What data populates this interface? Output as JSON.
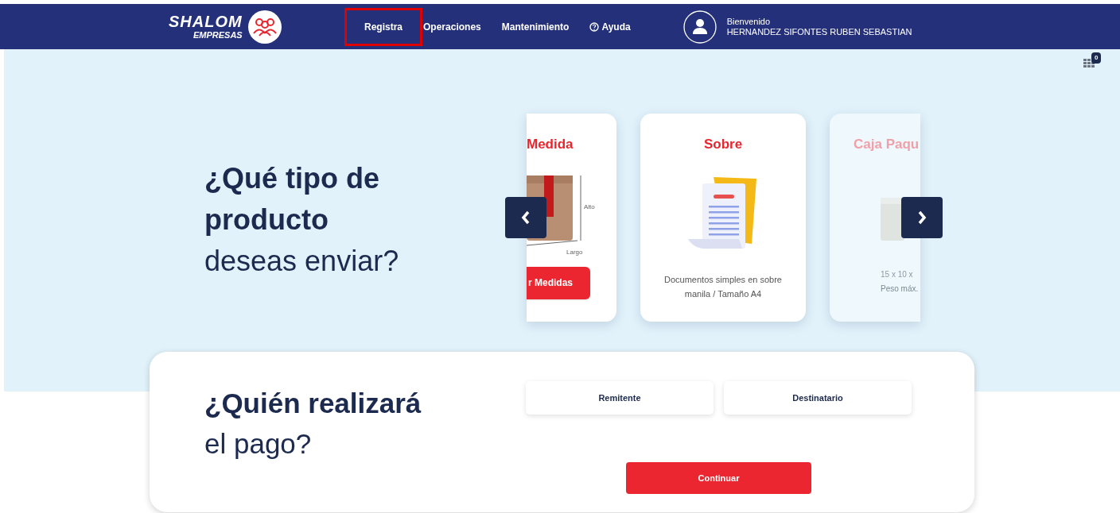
{
  "header": {
    "logo": {
      "title": "SHALOM",
      "subtitle": "EMPRESAS"
    },
    "nav": [
      {
        "label": "Registra",
        "highlighted": true,
        "kind": "plain"
      },
      {
        "label": "Operaciones",
        "highlighted": false,
        "kind": "plain"
      },
      {
        "label": "Mantenimiento",
        "highlighted": false,
        "kind": "plain"
      },
      {
        "label": "Ayuda",
        "highlighted": false,
        "kind": "help"
      }
    ],
    "user": {
      "greeting": "Bienvenido",
      "name": "HERNANDEZ SIFONTES RUBEN SEBASTIAN"
    }
  },
  "cart": {
    "count": "0"
  },
  "product": {
    "heading": [
      {
        "text": "¿Qué tipo de",
        "bold": true
      },
      {
        "text": "producto",
        "bold": true
      },
      {
        "text": "deseas enviar?",
        "bold": false
      }
    ],
    "cards": [
      {
        "kind": "measure",
        "title": "Medida",
        "labels": [
          "Alto",
          "Largo"
        ],
        "button": "r Medidas",
        "faded": false
      },
      {
        "kind": "envelope",
        "title": "Sobre",
        "description": "Documentos simples en sobre manila / Tamaño A4",
        "faded": false
      },
      {
        "kind": "box",
        "title": "Caja Paqu",
        "lines": [
          "15 x 10 x",
          "Peso máx."
        ],
        "faded": true
      }
    ]
  },
  "payment": {
    "heading": [
      {
        "text": "¿Quién realizará",
        "bold": true
      },
      {
        "text": "el pago?",
        "bold": false
      }
    ],
    "options": [
      {
        "label": "Remitente",
        "selected": false
      },
      {
        "label": "Destinatario",
        "selected": false
      }
    ],
    "button": "Continuar"
  }
}
